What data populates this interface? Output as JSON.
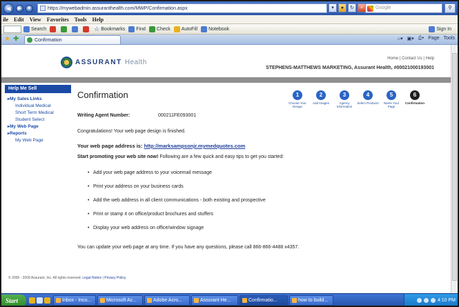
{
  "browser": {
    "url": "https://mywebadmin.assuranthealth.com/MWP/Confirmation.aspx",
    "search_placeholder": "Google",
    "menu": [
      "ile",
      "Edit",
      "View",
      "Favorites",
      "Tools",
      "Help"
    ],
    "toolbar": {
      "search_label": "Search",
      "bookmarks_label": "Bookmarks",
      "find_label": "Find",
      "check_label": "Check",
      "autofill_label": "AutoFill",
      "notebook_label": "Notebook",
      "signin_label": "Sign In"
    },
    "tab_title": "Confirmation",
    "command_bar": {
      "page_label": "Page",
      "tools_label": "Tools"
    }
  },
  "site": {
    "brand": "ASSURANT",
    "brand_sub": "Health",
    "header_links": "Home  |  Contact Us  |  Help",
    "account": "STEPHENS-MATTHEWS MARKETING, Assurant Health, #00021000193001"
  },
  "sidebar": {
    "title": "Help Me Sell",
    "sections": [
      {
        "label": "My Sales Links",
        "items": [
          "Individual Medical",
          "Short Term Medical",
          "Student Select"
        ]
      },
      {
        "label": "My Web Page",
        "items": []
      },
      {
        "label": "Reports",
        "items": [
          "My Web Page"
        ]
      }
    ]
  },
  "main": {
    "title": "Confirmation",
    "steps": [
      {
        "num": "1",
        "label": "Choose Your Design"
      },
      {
        "num": "2",
        "label": "Add Images"
      },
      {
        "num": "3",
        "label": "Agency Information"
      },
      {
        "num": "4",
        "label": "Select Products"
      },
      {
        "num": "5",
        "label": "Name Your Page"
      },
      {
        "num": "6",
        "label": "Confirmation"
      }
    ],
    "agent_label": "Writing Agent Number:",
    "agent_value": "000211FE093001",
    "congrats": "Congratulations! Your web page design is finished.",
    "address_label": "Your web page address is:",
    "address_link": "http://marksampsonjr.mymedquotes.com",
    "start_bold": "Start promoting your web site now!",
    "start_rest": " Following are a few quick and easy tips to get you started:",
    "tips": [
      "Add your web page address to your voicemail message",
      "Print your address on your business cards",
      "Add the web address in all client communications - both existing and prospective",
      "Print or stamp it on office/product brochures and stuffers",
      "Display your web address on office/window signage"
    ],
    "update_text": "You can update your web page at any time.  If you have any questions, please call 866-866-4488 x4357."
  },
  "footer": {
    "copyright": "© 2006 - 2009 Assurant, Inc. All rights reserved.",
    "legal_link": "Legal Notice",
    "privacy_link": "Privacy Policy"
  },
  "taskbar": {
    "start_label": "Start",
    "tasks": [
      "Inbox - Inco...",
      "Microsoft Ac...",
      "Adobe Acro...",
      "Assurant He...",
      "Confirmatio...",
      "how to build..."
    ],
    "clock": "4:10 PM"
  }
}
